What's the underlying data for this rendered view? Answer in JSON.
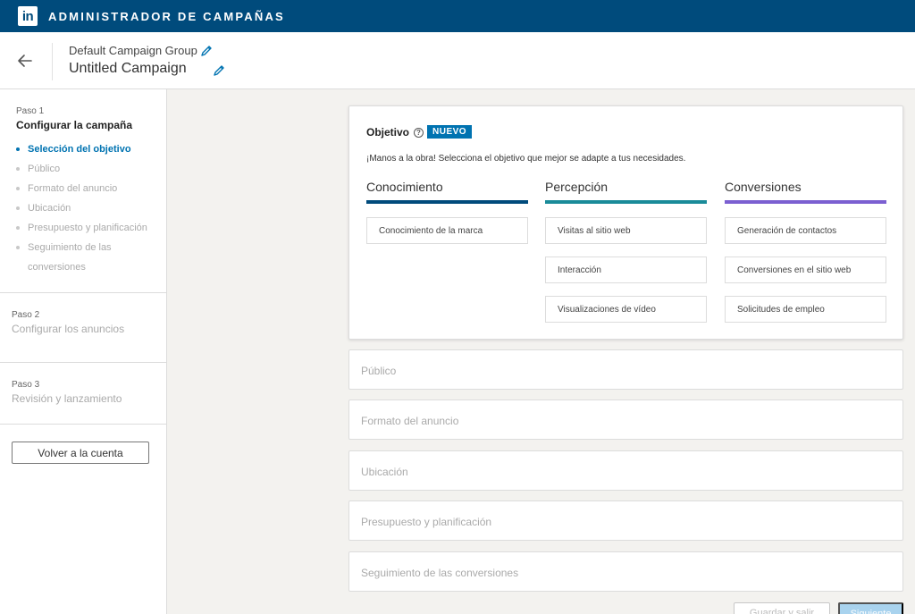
{
  "topbar": {
    "logo_text": "in",
    "title": "ADMINISTRADOR DE CAMPAÑAS"
  },
  "header": {
    "group_name": "Default Campaign Group",
    "campaign_name": "Untitled Campaign",
    "back_icon": "arrow-left-icon",
    "edit_icon": "pencil-icon"
  },
  "sidebar": {
    "step1": {
      "label": "Paso 1",
      "title": "Configurar la campaña",
      "items": [
        {
          "label": "Selección del objetivo",
          "active": true
        },
        {
          "label": "Público"
        },
        {
          "label": "Formato del anuncio"
        },
        {
          "label": "Ubicación"
        },
        {
          "label": "Presupuesto y planificación"
        },
        {
          "label": "Seguimiento de las conversiones"
        }
      ]
    },
    "step2": {
      "label": "Paso 2",
      "title": "Configurar los anuncios"
    },
    "step3": {
      "label": "Paso 3",
      "title": "Revisión y lanzamiento"
    },
    "return_button": "Volver a la cuenta"
  },
  "objective": {
    "title": "Objetivo",
    "help_icon": "question-circle-icon",
    "badge": "NUEVO",
    "description": "¡Manos a la obra! Selecciona el objetivo que mejor se adapte a tus necesidades.",
    "columns": [
      {
        "heading": "Conocimiento",
        "color": "#004b7c",
        "options": [
          "Conocimiento de la marca"
        ]
      },
      {
        "heading": "Percepción",
        "color": "#1a8b99",
        "options": [
          "Visitas al sitio web",
          "Interacción",
          "Visualizaciones de vídeo"
        ]
      },
      {
        "heading": "Conversiones",
        "color": "#7b5fd1",
        "options": [
          "Generación de contactos",
          "Conversiones en el sitio web",
          "Solicitudes de empleo"
        ]
      }
    ]
  },
  "sections": [
    "Público",
    "Formato del anuncio",
    "Ubicación",
    "Presupuesto y planificación",
    "Seguimiento de las conversiones"
  ],
  "footer": {
    "save_label": "Guardar y salir",
    "next_label": "Siguiente"
  },
  "colors": {
    "brand": "#004b7c",
    "accent": "#0073b1"
  }
}
